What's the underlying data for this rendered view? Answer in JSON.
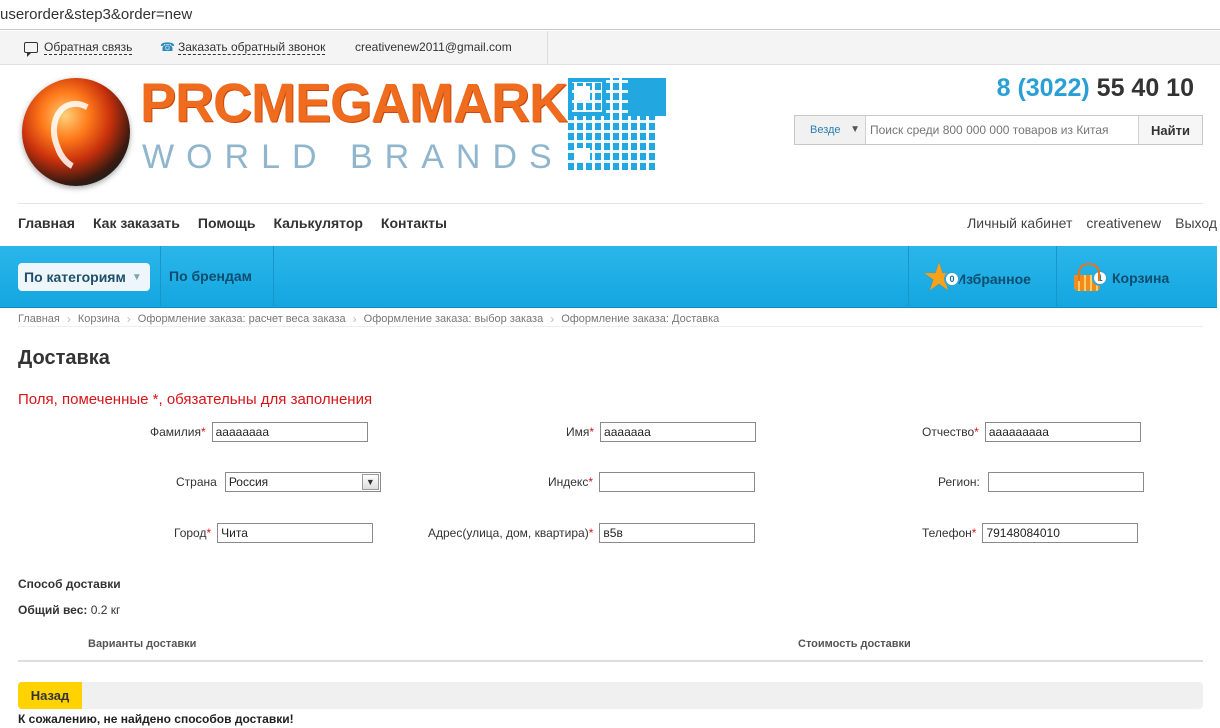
{
  "browser": {
    "url": "userorder&step3&order=new"
  },
  "topbar": {
    "feedback_label": "Обратная связь",
    "callback_label": "Заказать обратный звонок",
    "email": "creativenew2011@gmail.com"
  },
  "header": {
    "brand_name": "PRCMEGAMARKET",
    "brand_sub": "WORLD BRANDS",
    "phone_code": "8 (3022)",
    "phone_number": "55 40 10",
    "search": {
      "scope_label": "Везде",
      "placeholder": "Поиск среди 800 000 000 товаров из Китая",
      "button_label": "Найти"
    }
  },
  "menu": {
    "left": [
      "Главная",
      "Как заказать",
      "Помощь",
      "Калькулятор",
      "Контакты"
    ],
    "right": [
      "Личный кабинет",
      "creativenew",
      "Выход"
    ]
  },
  "catbar": {
    "categories_label": "По категориям",
    "brands_label": "По брендам",
    "favorites_label": "Избранное",
    "favorites_count": "0",
    "cart_label": "Корзина",
    "cart_count": "1"
  },
  "breadcrumb": [
    "Главная",
    "Корзина",
    "Оформление заказа: расчет веса заказа",
    "Оформление заказа: выбор заказа",
    "Оформление заказа: Доставка"
  ],
  "page": {
    "title": "Доставка",
    "required_note": "Поля, помеченные *, обязательны для заполнения"
  },
  "form": {
    "surname": {
      "label": "Фамилия",
      "value": "аааааааа"
    },
    "name": {
      "label": "Имя",
      "value": "ааааааа"
    },
    "patronymic": {
      "label": "Отчество",
      "value": "ааааааааа"
    },
    "country": {
      "label": "Страна",
      "value": "Россия"
    },
    "index": {
      "label": "Индекс",
      "value": ""
    },
    "region": {
      "label": "Регион:",
      "value": ""
    },
    "city": {
      "label": "Город",
      "value": "Чита"
    },
    "address": {
      "label": "Адрес(улица, дом, квартира)",
      "value": "в5в"
    },
    "phone": {
      "label": "Телефон",
      "value": "79148084010"
    },
    "required_mark": "*"
  },
  "delivery": {
    "method_label": "Способ доставки",
    "weight_label": "Общий вес:",
    "weight_value": "0.2 кг",
    "col_variants": "Варианты доставки",
    "col_cost": "Стоимость доставки",
    "back_label": "Назад",
    "not_found": "К сожалению, не найдено способов доставки!"
  },
  "colors": {
    "accent_blue": "#14a6e0",
    "brand_orange": "#ef6c1f",
    "required_red": "#d7141a",
    "back_yellow": "#ffd200"
  }
}
